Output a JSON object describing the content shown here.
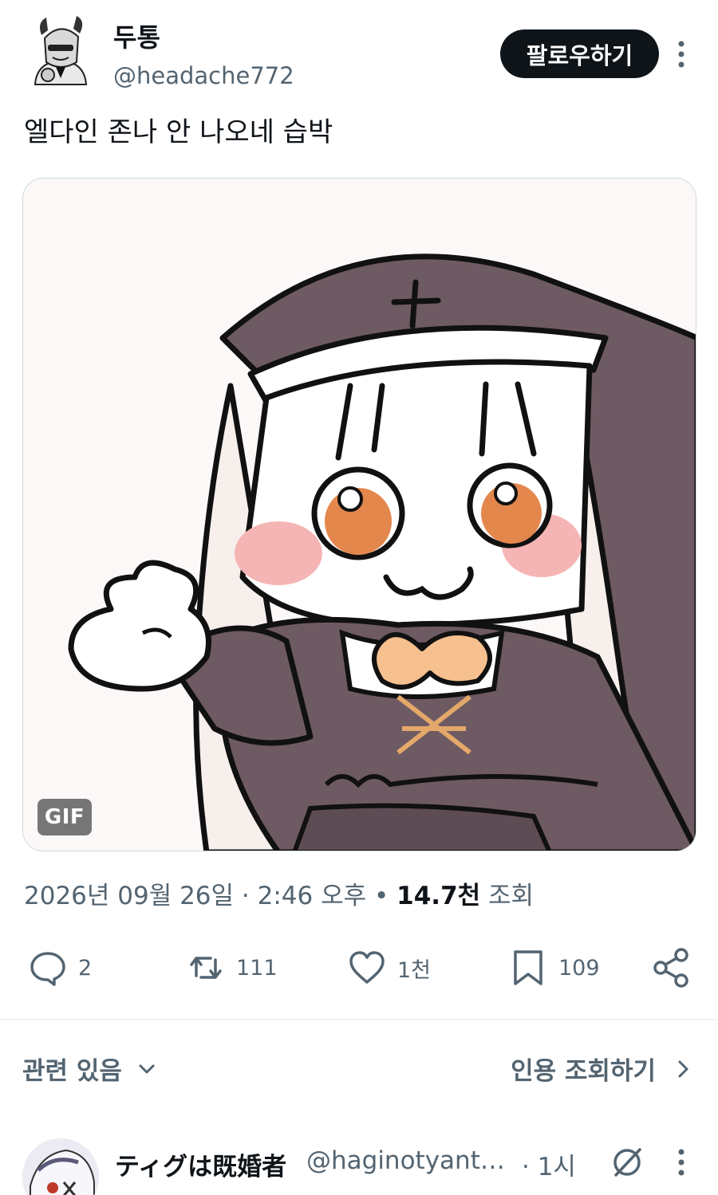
{
  "author": {
    "name": "두통",
    "handle": "@headache772",
    "follow_label": "팔로우하기"
  },
  "tweet": {
    "text": "엘다인 존나 안 나오네 습박",
    "media_badge": "GIF"
  },
  "meta": {
    "date": "2026년 09월 26일",
    "time": "2:46 오후",
    "views_count": "14.7천",
    "views_label": "조회"
  },
  "actions": {
    "replies": "2",
    "retweets": "111",
    "likes": "1천",
    "bookmarks": "109"
  },
  "related": {
    "label": "관련 있음",
    "quotes_label": "인용 조회하기"
  },
  "reply": {
    "name": "ティグは既婚者",
    "handle": "@haginotyant…",
    "time": "· 1시"
  },
  "colors": {
    "text_primary": "#0f1419",
    "text_secondary": "#536471",
    "border": "#cfd9de",
    "nun_robe": "#6e5a62",
    "eye_orange": "#e3874d",
    "blush": "#f5b5b4",
    "bow": "#f6c08f"
  },
  "icons": [
    "more-vertical-icon",
    "reply-icon",
    "retweet-icon",
    "like-icon",
    "bookmark-icon",
    "share-icon",
    "chevron-down-icon",
    "chevron-right-icon",
    "grok-icon"
  ]
}
